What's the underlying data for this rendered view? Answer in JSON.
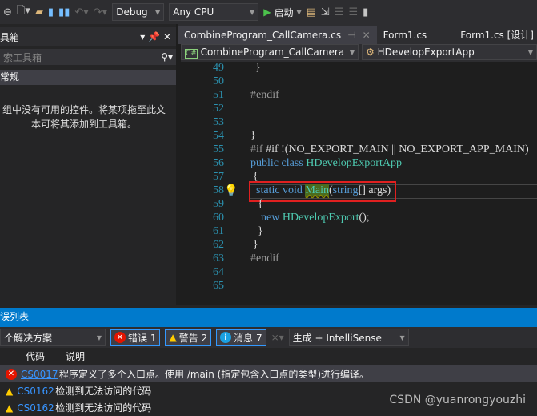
{
  "toolbar": {
    "config": "Debug",
    "platform": "Any CPU",
    "start": "启动"
  },
  "toolbox": {
    "title": "具箱",
    "search_placeholder": "索工具箱",
    "category": "常规",
    "empty_msg_1": "组中没有可用的控件。将某项拖至此文",
    "empty_msg_2": "本可将其添加到工具箱。"
  },
  "tabs": [
    {
      "label": "CombineProgram_CallCamera.cs"
    },
    {
      "label": "Form1.cs"
    },
    {
      "label": "Form1.cs [设计]"
    }
  ],
  "nav": {
    "project": "CombineProgram_CallCamera",
    "class": "HDevelopExportApp"
  },
  "code": {
    "lines": [
      "49",
      "50",
      "51",
      "52",
      "53",
      "54",
      "55",
      "56",
      "57",
      "58",
      "59",
      "60",
      "61",
      "62",
      "63",
      "64",
      "65"
    ],
    "l49": "}",
    "l51": "#endif",
    "l54": "}",
    "l55": "#if !(NO_EXPORT_MAIN || NO_EXPORT_APP_MAIN)",
    "l56a": "public class ",
    "l56b": "HDevelopExportApp",
    "l57": "{",
    "l58a": "static void ",
    "l58b": "Main",
    "l58c": "(",
    "l58d": "string",
    "l58e": "[] args)",
    "l59": "{",
    "l60a": "new ",
    "l60b": "HDevelopExport",
    "l60c": "();",
    "l61": "}",
    "l62": "}",
    "l63": "#endif"
  },
  "errors": {
    "title": "误列表",
    "scope": "个解决方案",
    "errors_btn": "错误 1",
    "warnings_btn": "警告 2",
    "messages_btn": "消息 7",
    "source": "生成 + IntelliSense",
    "col_code": "代码",
    "col_desc": "说明",
    "rows": [
      {
        "type": "error",
        "code": "CS0017",
        "desc": "程序定义了多个入口点。使用 /main (指定包含入口点的类型)进行编译。"
      },
      {
        "type": "warning",
        "code": "CS0162",
        "desc": "检测到无法访问的代码"
      },
      {
        "type": "warning",
        "code": "CS0162",
        "desc": "检测到无法访问的代码"
      }
    ]
  },
  "watermark": "CSDN @yuanrongyouzhi"
}
